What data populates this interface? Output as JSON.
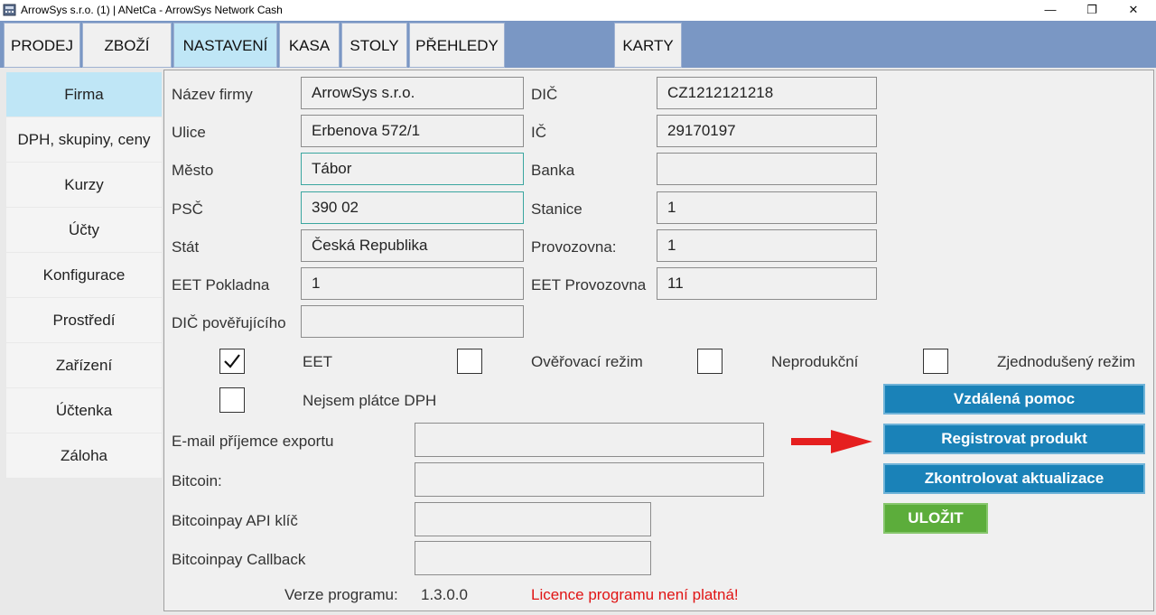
{
  "window": {
    "title": "ArrowSys s.r.o. (1) | ANetCa - ArrowSys Network Cash",
    "app_icon": "register-icon",
    "controls": {
      "minimize": "—",
      "maximize": "❐",
      "close": "✕"
    }
  },
  "tabs": [
    {
      "label": "PRODEJ",
      "active": false
    },
    {
      "label": "ZBOŽÍ",
      "active": false
    },
    {
      "label": "NASTAVENÍ",
      "active": true
    },
    {
      "label": "KASA",
      "active": false
    },
    {
      "label": "STOLY",
      "active": false
    },
    {
      "label": "PŘEHLEDY",
      "active": false
    },
    {
      "label": "KARTY",
      "active": false
    }
  ],
  "sidebar": {
    "items": [
      {
        "label": "Firma",
        "active": true
      },
      {
        "label": "DPH, skupiny, ceny"
      },
      {
        "label": "Kurzy"
      },
      {
        "label": "Účty"
      },
      {
        "label": "Konfigurace"
      },
      {
        "label": "Prostředí"
      },
      {
        "label": "Zařízení"
      },
      {
        "label": "Účtenka"
      },
      {
        "label": "Záloha"
      }
    ]
  },
  "form": {
    "left": [
      {
        "label": "Název firmy",
        "value": "ArrowSys s.r.o."
      },
      {
        "label": "Ulice",
        "value": "Erbenova 572/1"
      },
      {
        "label": "Město",
        "value": "Tábor"
      },
      {
        "label": "PSČ",
        "value": "390 02"
      },
      {
        "label": "Stát",
        "value": "Česká Republika"
      },
      {
        "label": "EET Pokladna",
        "value": "1"
      },
      {
        "label": "DIČ pověřujícího",
        "value": ""
      }
    ],
    "right": [
      {
        "label": "DIČ",
        "value": "CZ1212121218"
      },
      {
        "label": "IČ",
        "value": "29170197"
      },
      {
        "label": "Banka",
        "value": ""
      },
      {
        "label": "Stanice",
        "value": "1"
      },
      {
        "label": "Provozovna:",
        "value": "1"
      },
      {
        "label": "EET Provozovna",
        "value": "11"
      }
    ],
    "checkboxes": [
      {
        "label": "EET",
        "checked": true
      },
      {
        "label": "Ověřovací režim",
        "checked": false
      },
      {
        "label": "Neprodukční",
        "checked": false
      },
      {
        "label": "Zjednodušený režim",
        "checked": false
      },
      {
        "label": "Nejsem plátce DPH",
        "checked": false
      }
    ],
    "lower": [
      {
        "label": "E-mail příjemce exportu",
        "value": ""
      },
      {
        "label": "Bitcoin:",
        "value": ""
      },
      {
        "label": "Bitcoinpay API klíč",
        "value": ""
      },
      {
        "label": "Bitcoinpay Callback",
        "value": ""
      }
    ]
  },
  "buttons": {
    "remote_help": "Vzdálená pomoc",
    "register": "Registrovat produkt",
    "check_updates": "Zkontrolovat aktualizace",
    "save": "ULOŽIT"
  },
  "footer": {
    "version_label": "Verze programu:",
    "version_value": "1.3.0.0",
    "license_warning": "Licence programu není platná!"
  },
  "colors": {
    "tabbar": "#7a97c4",
    "active_tab": "#bfe6f6",
    "button_blue": "#1a82b8",
    "button_green": "#5cad3b",
    "warning_red": "#e01414",
    "arrow_red": "#e51f1f"
  }
}
